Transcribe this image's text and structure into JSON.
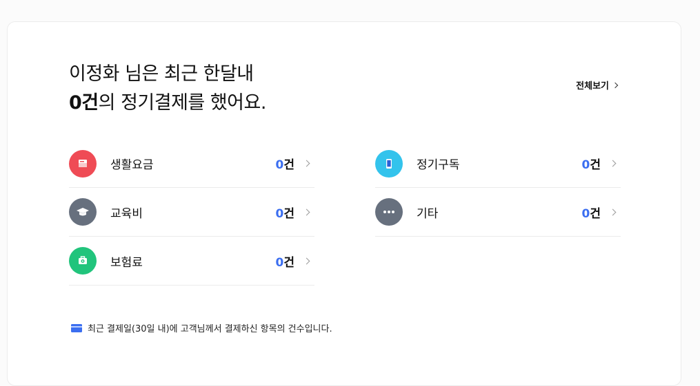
{
  "header": {
    "line1": "이정화 님은 최근 한달내",
    "count": "0건",
    "line2_suffix": "의 정기결제를 했어요.",
    "view_all": "전체보기"
  },
  "categories": [
    {
      "label": "생활요금",
      "count": "0",
      "unit": "건",
      "icon": "receipt-icon",
      "color": "#ef4b55"
    },
    {
      "label": "정기구독",
      "count": "0",
      "unit": "건",
      "icon": "phone-icon",
      "color": "#33c3ec"
    },
    {
      "label": "교육비",
      "count": "0",
      "unit": "건",
      "icon": "graduation-cap-icon",
      "color": "#67707e"
    },
    {
      "label": "기타",
      "count": "0",
      "unit": "건",
      "icon": "more-icon",
      "color": "#67707e"
    },
    {
      "label": "보험료",
      "count": "0",
      "unit": "건",
      "icon": "medical-kit-icon",
      "color": "#21c47c"
    }
  ],
  "note": {
    "icon": "credit-card-icon",
    "text": "최근 결제일(30일 내)에 고객님께서 결제하신 항목의 건수입니다."
  }
}
